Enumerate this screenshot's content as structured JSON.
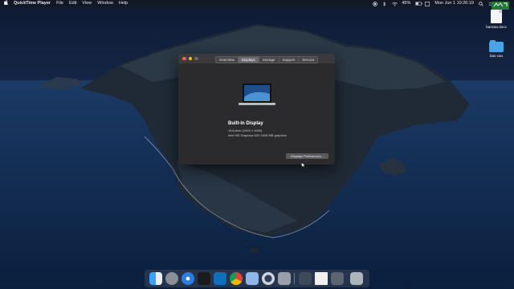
{
  "menubar": {
    "apple": "",
    "app_name": "QuickTime Player",
    "menus": [
      "File",
      "Edit",
      "View",
      "Window",
      "Help"
    ],
    "battery": "45%",
    "clock": "Mon Jun 1  10:26:19"
  },
  "corner_badge": "",
  "desktop": {
    "icons": [
      {
        "label": "baocao.docx",
        "icon": "word-document-icon"
      },
      {
        "label": "bao cao",
        "icon": "folder-icon"
      }
    ]
  },
  "window": {
    "tabs": [
      "Overview",
      "Displays",
      "Storage",
      "Support",
      "Service"
    ],
    "active_tab": "Displays",
    "display_name": "Built-in Display",
    "display_size": "15.6-inch (1920 x 1080)",
    "graphics": "Intel HD Graphics 520 1536 MB graphics",
    "button": "Displays Preferences..."
  },
  "dock": {
    "items": [
      "finder-icon",
      "launchpad-icon",
      "safari-icon",
      "terminal-icon",
      "vscode-icon",
      "chrome-icon",
      "preview-icon",
      "quicktime-icon",
      "system-preferences-icon",
      "photos-icon",
      "document-icon",
      "finder-window-icon",
      "downloads-icon",
      "trash-icon"
    ]
  }
}
